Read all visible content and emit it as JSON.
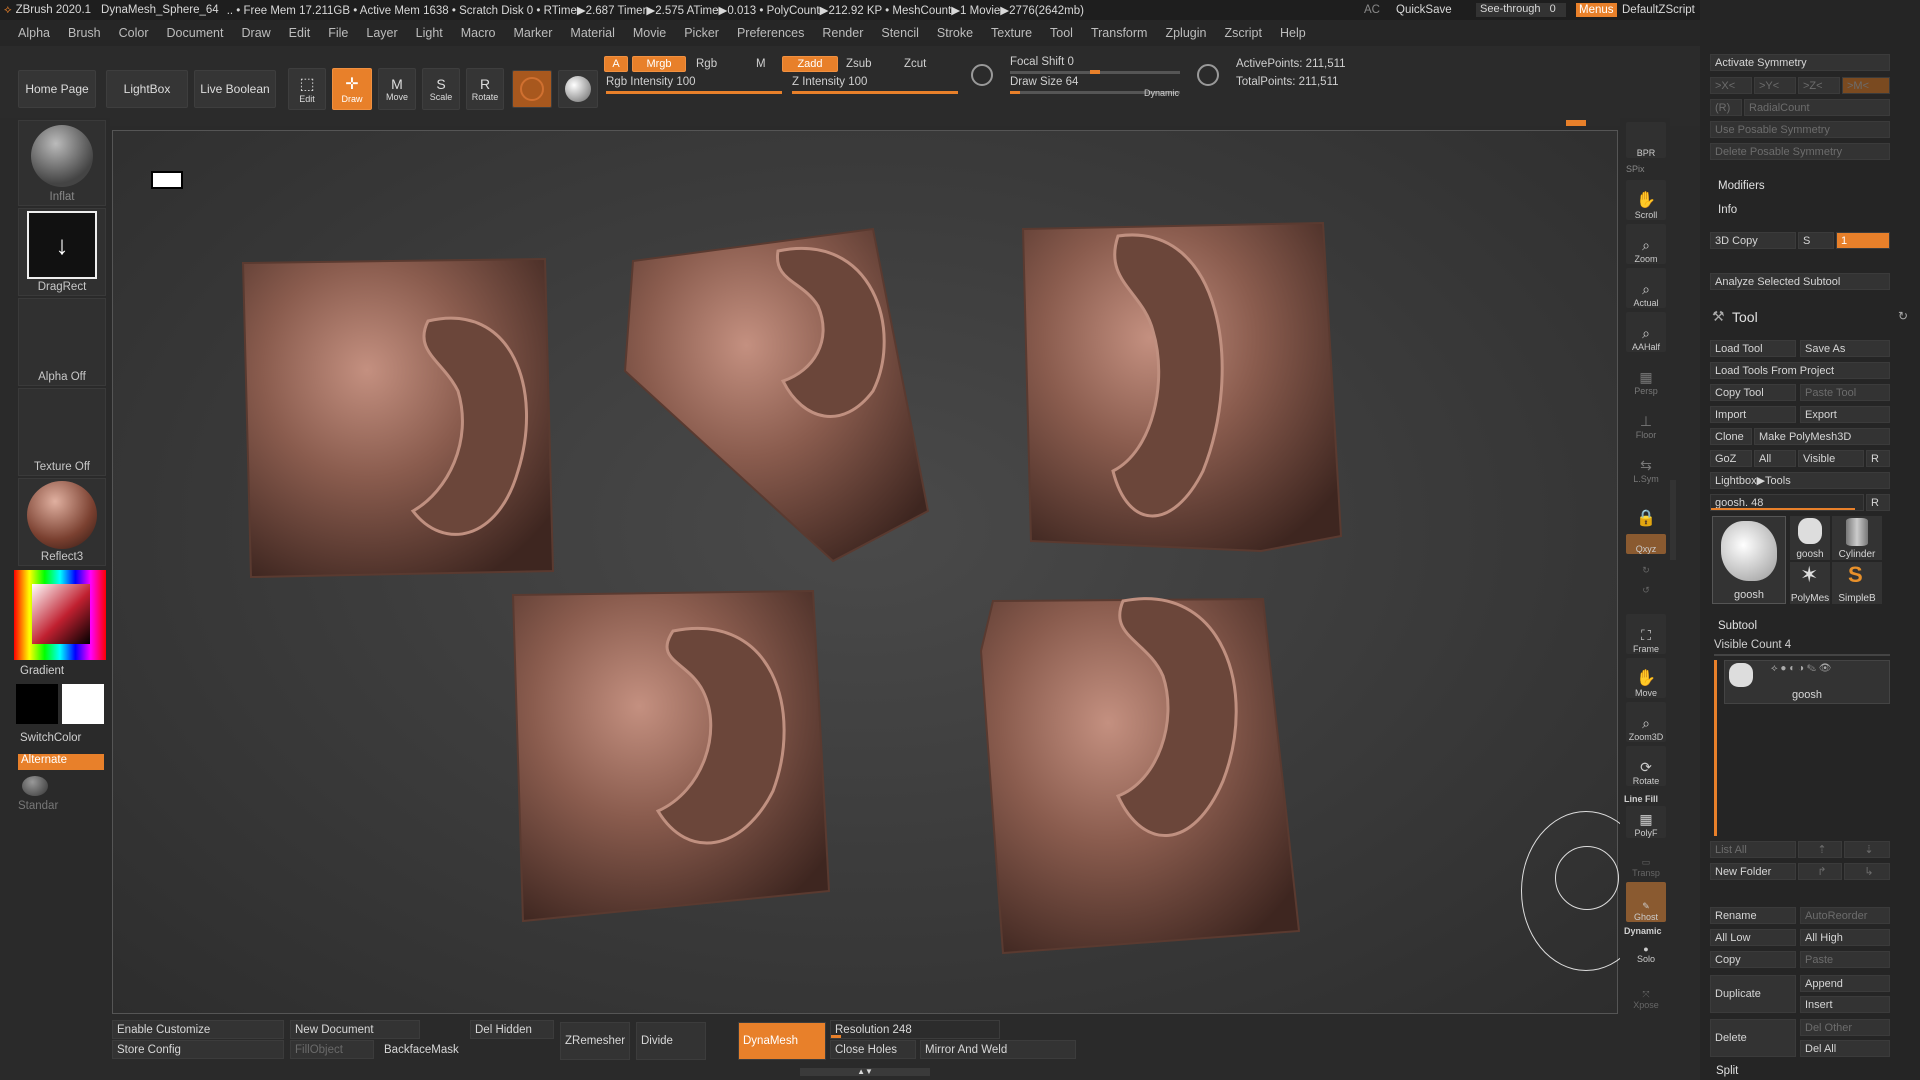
{
  "titlebar": {
    "app": "ZBrush 2020.1",
    "file": "DynaMesh_Sphere_64",
    "stats": ".. • Free Mem 17.211GB • Active Mem 1638 • Scratch Disk 0 • RTime▶2.687 Timer▶2.575 ATime▶0.013 • PolyCount▶212.92 KP • MeshCount▶1 Movie▶2776(2642mb)",
    "ac": "AC",
    "quicksave": "QuickSave",
    "see_through": "See-through",
    "see_through_value": "0",
    "menus": "Menus",
    "script": "DefaultZScript"
  },
  "menubar": [
    "Alpha",
    "Brush",
    "Color",
    "Document",
    "Draw",
    "Edit",
    "File",
    "Layer",
    "Light",
    "Macro",
    "Marker",
    "Material",
    "Movie",
    "Picker",
    "Preferences",
    "Render",
    "Stencil",
    "Stroke",
    "Texture",
    "Tool",
    "Transform",
    "Zplugin",
    "Zscript",
    "Help"
  ],
  "toolbar": {
    "home": "Home Page",
    "lightbox": "LightBox",
    "liveboolean": "Live Boolean",
    "edit": "Edit",
    "draw": "Draw",
    "move": "Move",
    "scale": "Scale",
    "rotate": "Rotate",
    "a": "A",
    "mrgb": "Mrgb",
    "rgb": "Rgb",
    "m": "M",
    "zadd": "Zadd",
    "zsub": "Zsub",
    "zcut": "Zcut",
    "rgb_intensity_label": "Rgb Intensity",
    "rgb_intensity": "100",
    "rgb_intensity_fraction": 1.0,
    "z_intensity_label": "Z Intensity",
    "z_intensity": "100",
    "z_intensity_fraction": 1.0,
    "focal_label": "Focal Shift",
    "focal": "0",
    "focal_fraction": 0.5,
    "draw_size_label": "Draw Size",
    "draw_size": "64",
    "draw_size_fraction": 0.06,
    "dynamic": "Dynamic",
    "active_points": "ActivePoints: 211,511",
    "total_points": "TotalPoints: 211,511"
  },
  "leftshelf": {
    "brush": "Inflat",
    "stroke": "DragRect",
    "alpha": "Alpha Off",
    "texture": "Texture Off",
    "material": "Reflect3",
    "gradient": "Gradient",
    "switchcolor": "SwitchColor",
    "alternate": "Alternate",
    "standard": "Standar"
  },
  "rightshelf": [
    "BPR",
    "SPix",
    "Scroll",
    "Zoom",
    "Actual",
    "AAHalf",
    "Persp",
    "Floor",
    "L.Sym",
    "",
    "Qxyz",
    "",
    "",
    "Frame",
    "Move",
    "Zoom3D",
    "Rotate",
    "Line Fill",
    "PolyF",
    "Transp",
    "Ghost",
    "Dynamic",
    "Solo",
    "Xpose"
  ],
  "panel": {
    "activate_symmetry": "Activate Symmetry",
    "x": ">X<",
    "y": ">Y<",
    "z": ">Z<",
    "m": ">M<",
    "r": "(R)",
    "radialcount": "RadialCount",
    "use_posable": "Use Posable Symmetry",
    "delete_posable": "Delete Posable Symmetry",
    "modifiers": "Modifiers",
    "info": "Info",
    "copy3d": "3D Copy",
    "s": "S",
    "s_value": "1",
    "analyze": "Analyze Selected Subtool",
    "tool": "Tool",
    "load_tool": "Load Tool",
    "save_as": "Save As",
    "load_from_project": "Load Tools From Project",
    "copy_tool": "Copy Tool",
    "paste_tool": "Paste Tool",
    "import": "Import",
    "export": "Export",
    "clone": "Clone",
    "make_polymesh": "Make PolyMesh3D",
    "goz": "GoZ",
    "all": "All",
    "visible": "Visible",
    "r2": "R",
    "lightbox_tools": "Lightbox▶Tools",
    "goosh_slider": "goosh. 48",
    "goosh_fraction": 0.95,
    "thumbs": [
      "goosh",
      "goosh",
      "Cylinder",
      "PolyMes",
      "SimpleB"
    ],
    "subtool": "Subtool",
    "visible_count": "Visible Count 4",
    "subtool_name": "goosh",
    "list_all": "List All",
    "new_folder": "New Folder",
    "rename": "Rename",
    "autoreorder": "AutoReorder",
    "all_low": "All Low",
    "all_high": "All High",
    "copy": "Copy",
    "paste": "Paste",
    "duplicate": "Duplicate",
    "append": "Append",
    "insert": "Insert",
    "delete": "Delete",
    "del_other": "Del Other",
    "del_all": "Del All",
    "split": "Split"
  },
  "bottombar": {
    "enable_customize": "Enable Customize",
    "new_document": "New Document",
    "del_hidden": "Del Hidden",
    "zremesher": "ZRemesher",
    "divide": "Divide",
    "dynamesh": "DynaMesh",
    "resolution": "Resolution 248",
    "resolution_fraction": 0.06,
    "store_config": "Store Config",
    "fillobject": "FillObject",
    "backfacemask": "BackfaceMask",
    "close_holes": "Close Holes",
    "mirror_weld": "Mirror And Weld"
  },
  "colors": {
    "accent": "#e8802a",
    "bg": "#2a2a2a",
    "clay": "#8a5c4e"
  }
}
